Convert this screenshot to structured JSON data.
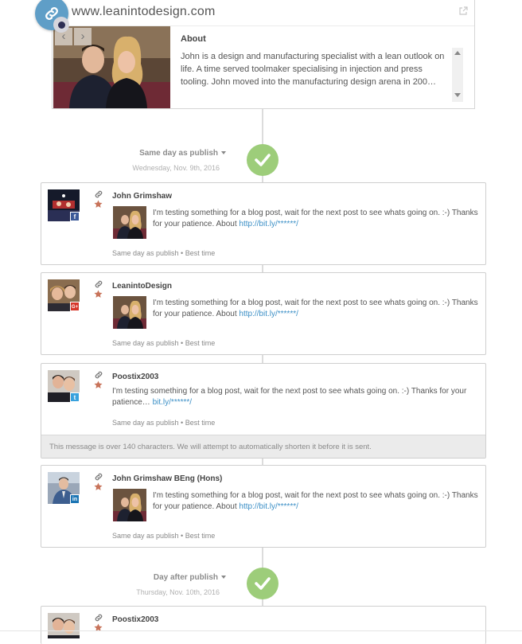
{
  "link_preview": {
    "url": "www.leanintodesign.com",
    "about_title": "About",
    "about_text": "John is a design and manufacturing specialist with a lean outlook on life. A time served toolmaker specialising in injection and press tooling. John moved into the manufacturing design arena in 200…",
    "prev_label": "‹",
    "next_label": "›"
  },
  "separators": [
    {
      "label": "Same day as publish",
      "date": "Wednesday, Nov. 9th, 2016"
    },
    {
      "label": "Day after publish",
      "date": "Thursday, Nov. 10th, 2016"
    }
  ],
  "posts": [
    {
      "author": "John Grimshaw",
      "network": "facebook",
      "network_glyph": "f",
      "network_color": "#3b5998",
      "message": "I'm testing something for a blog post, wait for the next post to see whats going on. :-) Thanks for your patience. About",
      "link": "http://bit.ly/******/",
      "meta": "Same day as publish • Best time"
    },
    {
      "author": "LeanintoDesign",
      "network": "google-plus",
      "network_glyph": "G+",
      "network_color": "#d6362a",
      "message": "I'm testing something for a blog post, wait for the next post to see whats going on. :-) Thanks for your patience. About",
      "link": "http://bit.ly/******/",
      "meta": "Same day as publish • Best time"
    },
    {
      "author": "Poostix2003",
      "network": "twitter",
      "network_glyph": "t",
      "network_color": "#38a1dd",
      "message": "I'm testing something for a blog post, wait for the next post to see whats going on. :-) Thanks for your patience…",
      "link": "bit.ly/******/",
      "meta": "Same day as publish • Best time",
      "warning": "This message is over 140 characters. We will attempt to automatically shorten it before it is sent."
    },
    {
      "author": "John Grimshaw BEng (Hons)",
      "network": "linkedin",
      "network_glyph": "in",
      "network_color": "#1b75b4",
      "message": "I'm testing something for a blog post, wait for the next post to see whats going on. :-) Thanks for your patience. About",
      "link": "http://bit.ly/******/",
      "meta": "Same day as publish • Best time"
    },
    {
      "author": "Poostix2003",
      "network": "twitter"
    }
  ],
  "colors": {
    "accent_link": "#3b8fc6",
    "check_green": "#9dcd7a",
    "link_badge": "#5f9ec7"
  }
}
